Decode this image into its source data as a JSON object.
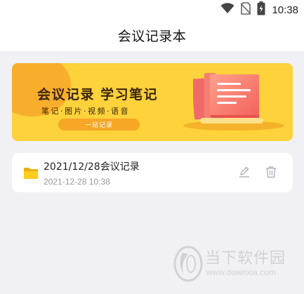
{
  "status_bar": {
    "time": "10:38",
    "icons": [
      "wifi-icon",
      "no-sim-icon",
      "battery-charging-icon"
    ]
  },
  "app_bar": {
    "title": "会议记录本"
  },
  "banner": {
    "title": "会议记录 学习笔记",
    "subtitle": "笔记·图片·视频·语音",
    "button_label": "一站记录",
    "colors": {
      "background": "#fdd23a",
      "accent": "#f6a725",
      "doc": "#fb7a6c"
    }
  },
  "notes": [
    {
      "title": "2021/12/28会议记录",
      "date": "2021-12-28 10:38",
      "icon": "folder-icon",
      "actions": [
        "edit-icon",
        "trash-icon"
      ]
    }
  ],
  "watermark": {
    "name": "当下软件园",
    "url": "www.downxia.com"
  }
}
